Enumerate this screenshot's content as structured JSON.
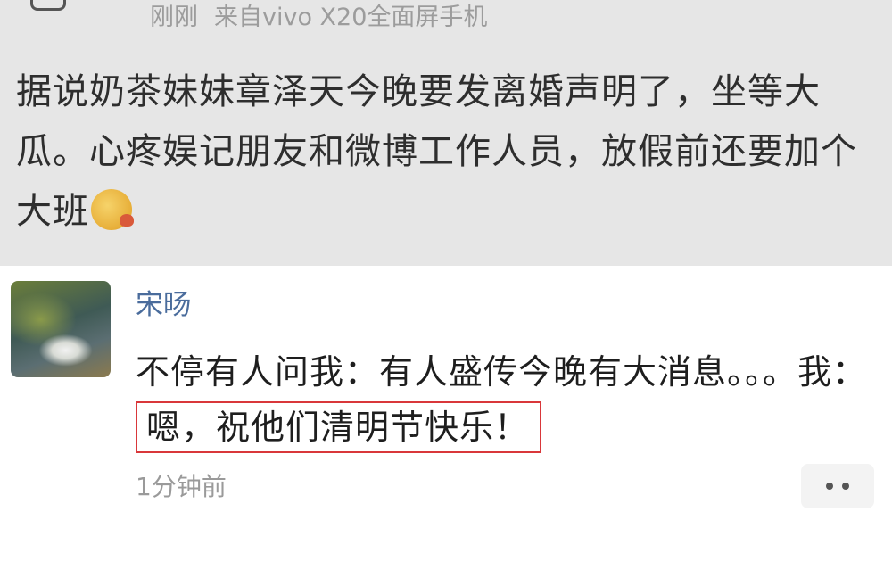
{
  "post": {
    "time": "刚刚",
    "source": "来自vivo X20全面屏手机",
    "body": "据说奶茶妹妹章泽天今晚要发离婚声明了，坐等大瓜。心疼娱记朋友和微博工作人员，放假前还要加个大班",
    "emoji_icon": "smirk-emoji"
  },
  "comment": {
    "username": "宋旸",
    "text_before": "不停有人问我：有人盛传今晚有大消息。。。我：",
    "text_highlight": "嗯，祝他们清明节快乐！",
    "time": "1分钟前",
    "more_icon": "more-dots-icon",
    "highlight_color": "#d9373a",
    "username_color": "#4a6c9c"
  }
}
